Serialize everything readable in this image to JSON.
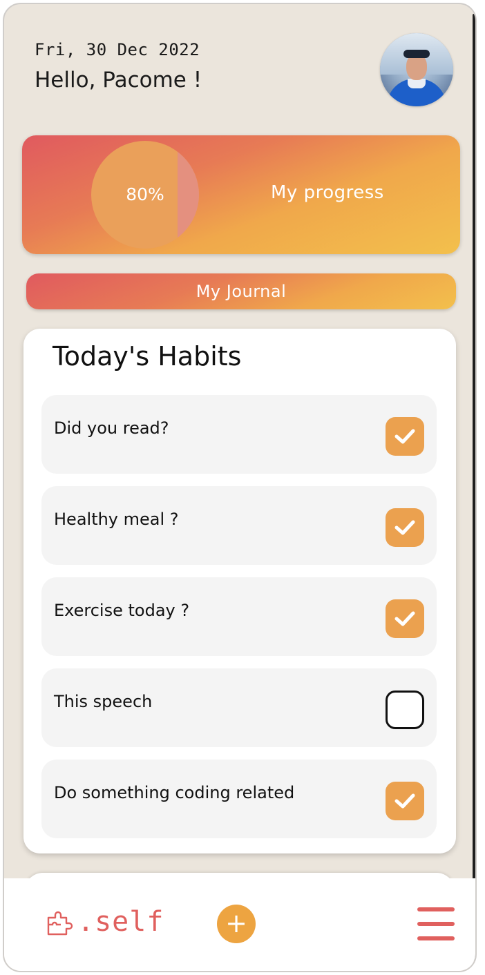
{
  "header": {
    "date": "Fri, 30 Dec 2022",
    "greeting": "Hello, Pacome !"
  },
  "progress": {
    "percent_label": "80%",
    "percent_value": 80,
    "label": "My progress"
  },
  "journal": {
    "label": "My Journal"
  },
  "habits": {
    "title": "Today's Habits",
    "items": [
      {
        "label": "Did you read?",
        "checked": true
      },
      {
        "label": "Healthy meal ?",
        "checked": true
      },
      {
        "label": "Exercise today ?",
        "checked": true
      },
      {
        "label": "This speech",
        "checked": false
      },
      {
        "label": "Do something coding related",
        "checked": true
      }
    ]
  },
  "bottom_nav": {
    "logo_text": ".self",
    "add_icon": "plus-icon",
    "menu_icon": "hamburger-menu-icon"
  },
  "colors": {
    "accent_orange": "#eba14f",
    "accent_red": "#e0605e",
    "background": "#ebe5dc"
  }
}
